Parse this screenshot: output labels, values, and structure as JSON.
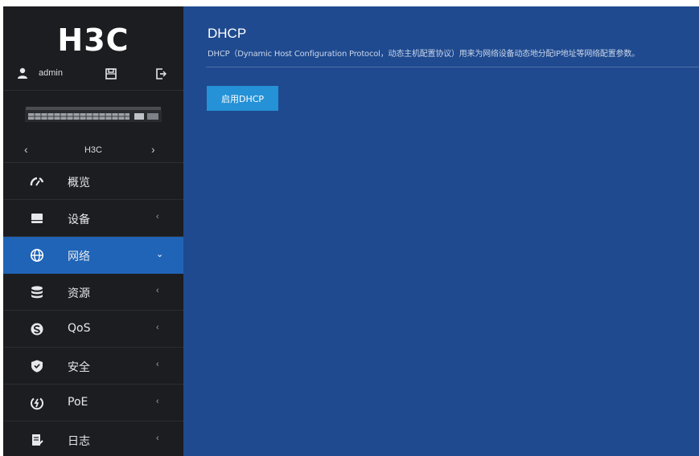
{
  "sidebar": {
    "logo": "H3C",
    "user": {
      "name": "admin"
    },
    "device": {
      "name": "H3C",
      "prev": "‹",
      "next": "›"
    },
    "menu": [
      {
        "label": "概览",
        "icon": "dashboard-icon",
        "arrow": ""
      },
      {
        "label": "设备",
        "icon": "device-icon",
        "arrow": "‹"
      },
      {
        "label": "网络",
        "icon": "globe-icon",
        "arrow": "⌄",
        "active": true
      },
      {
        "label": "资源",
        "icon": "database-icon",
        "arrow": "‹"
      },
      {
        "label": "QoS",
        "icon": "qos-icon",
        "arrow": "‹"
      },
      {
        "label": "安全",
        "icon": "shield-icon",
        "arrow": "‹"
      },
      {
        "label": "PoE",
        "icon": "poe-icon",
        "arrow": "‹"
      },
      {
        "label": "日志",
        "icon": "log-icon",
        "arrow": "‹"
      }
    ]
  },
  "main": {
    "title": "DHCP",
    "description": "DHCP（Dynamic Host Configuration Protocol，动态主机配置协议）用来为网络设备动态地分配IP地址等网络配置参数。",
    "enable_button": "启用DHCP"
  },
  "colors": {
    "sidebar_bg": "#1c1d20",
    "main_bg": "#1f4a8f",
    "active_item": "#1f64b7",
    "button": "#2591d6"
  }
}
